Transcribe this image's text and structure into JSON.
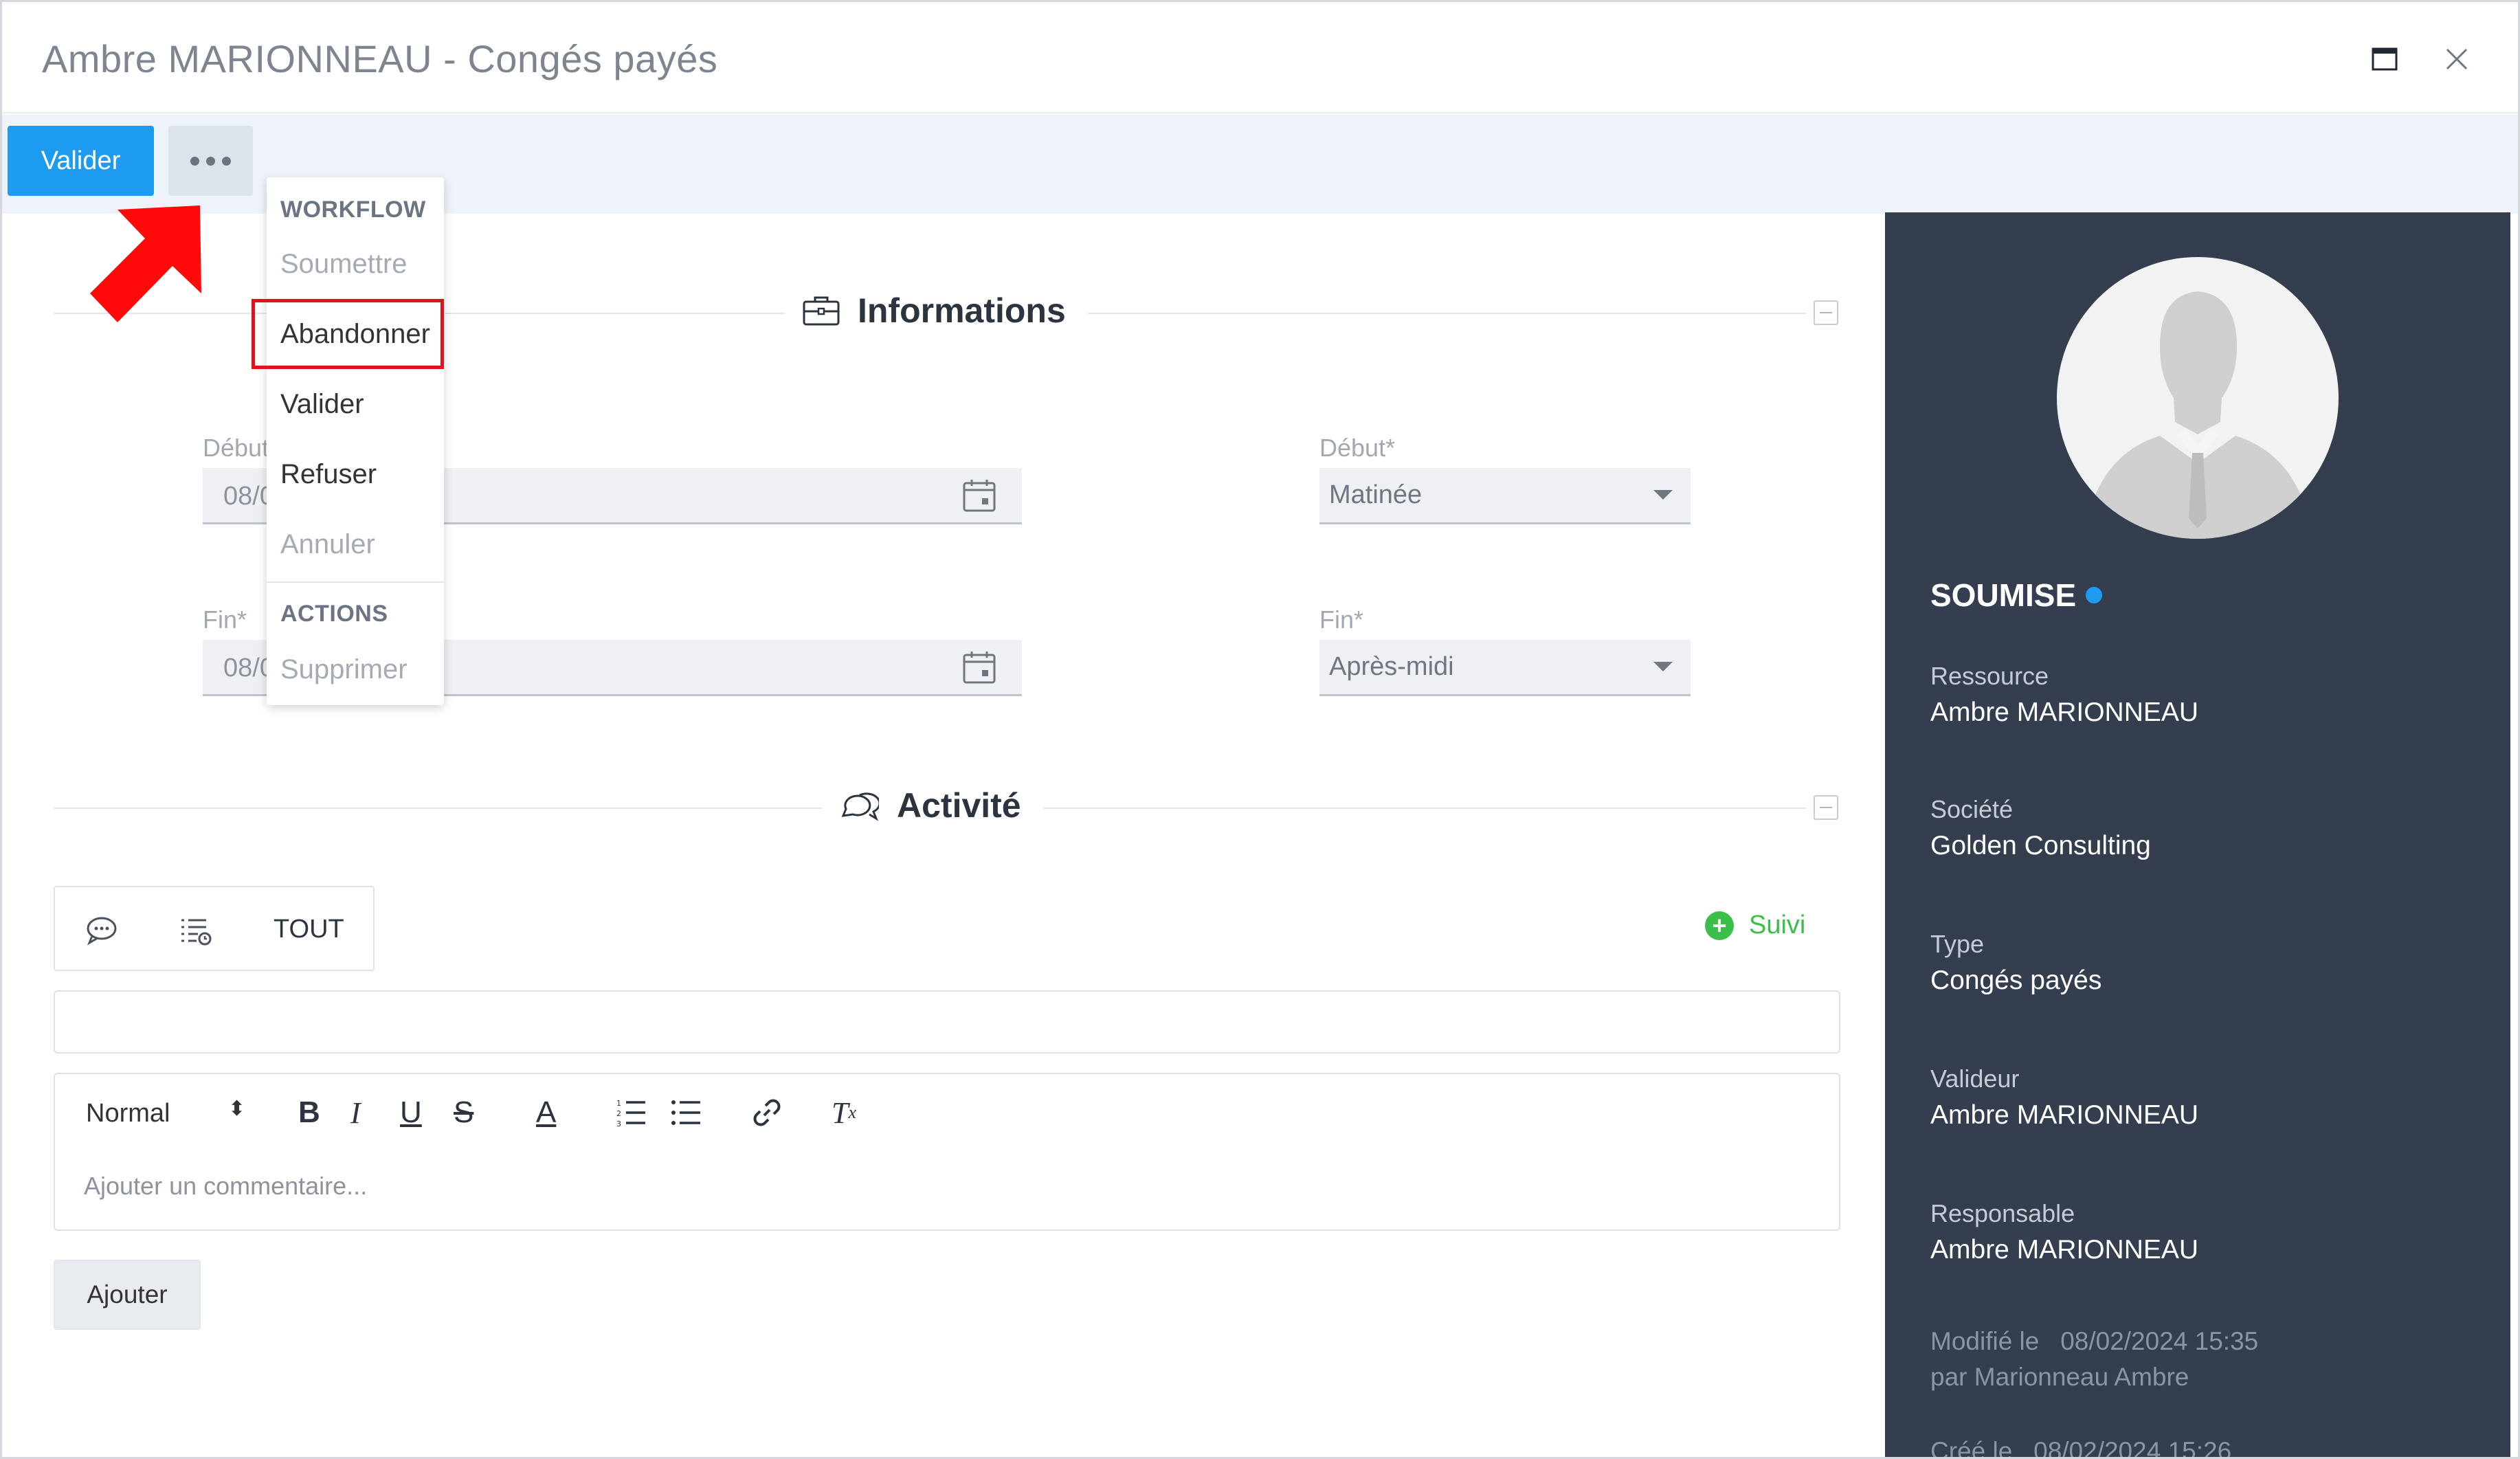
{
  "window": {
    "title": "Ambre MARIONNEAU - Congés payés"
  },
  "toolbar": {
    "valider_label": "Valider"
  },
  "menu": {
    "workflow_header": "WORKFLOW",
    "soumettre": "Soumettre",
    "abandonner": "Abandonner",
    "valider": "Valider",
    "refuser": "Refuser",
    "annuler": "Annuler",
    "actions_header": "ACTIONS",
    "supprimer": "Supprimer"
  },
  "informations": {
    "title": "Informations",
    "debut_date_label": "Début",
    "debut_date_value": "08/0",
    "debut_period_label": "Début*",
    "debut_period_value": "Matinée",
    "fin_date_label": "Fin*",
    "fin_date_value": "08/0",
    "fin_period_label": "Fin*",
    "fin_period_value": "Après-midi"
  },
  "activite": {
    "title": "Activité",
    "tab_all": "TOUT",
    "suivi_label": "Suivi",
    "editor_format": "Normal",
    "comment_placeholder": "Ajouter un commentaire...",
    "add_button": "Ajouter"
  },
  "sidepanel": {
    "status": "SOUMISE",
    "ressource_label": "Ressource",
    "ressource_value": "Ambre MARIONNEAU",
    "societe_label": "Société",
    "societe_value": "Golden Consulting",
    "type_label": "Type",
    "type_value": "Congés payés",
    "valideur_label": "Valideur",
    "valideur_value": "Ambre MARIONNEAU",
    "responsable_label": "Responsable",
    "responsable_value": "Ambre MARIONNEAU",
    "modifie": "Modifié le   08/02/2024 15:35",
    "modifie_par": "par Marionneau Ambre",
    "cree": "Créé le   08/02/2024 15:26"
  },
  "colors": {
    "primary": "#1d9bf0",
    "sidepanel_bg": "#343e4e",
    "highlight": "#e1121e",
    "suivi_green": "#3bbf4a"
  }
}
